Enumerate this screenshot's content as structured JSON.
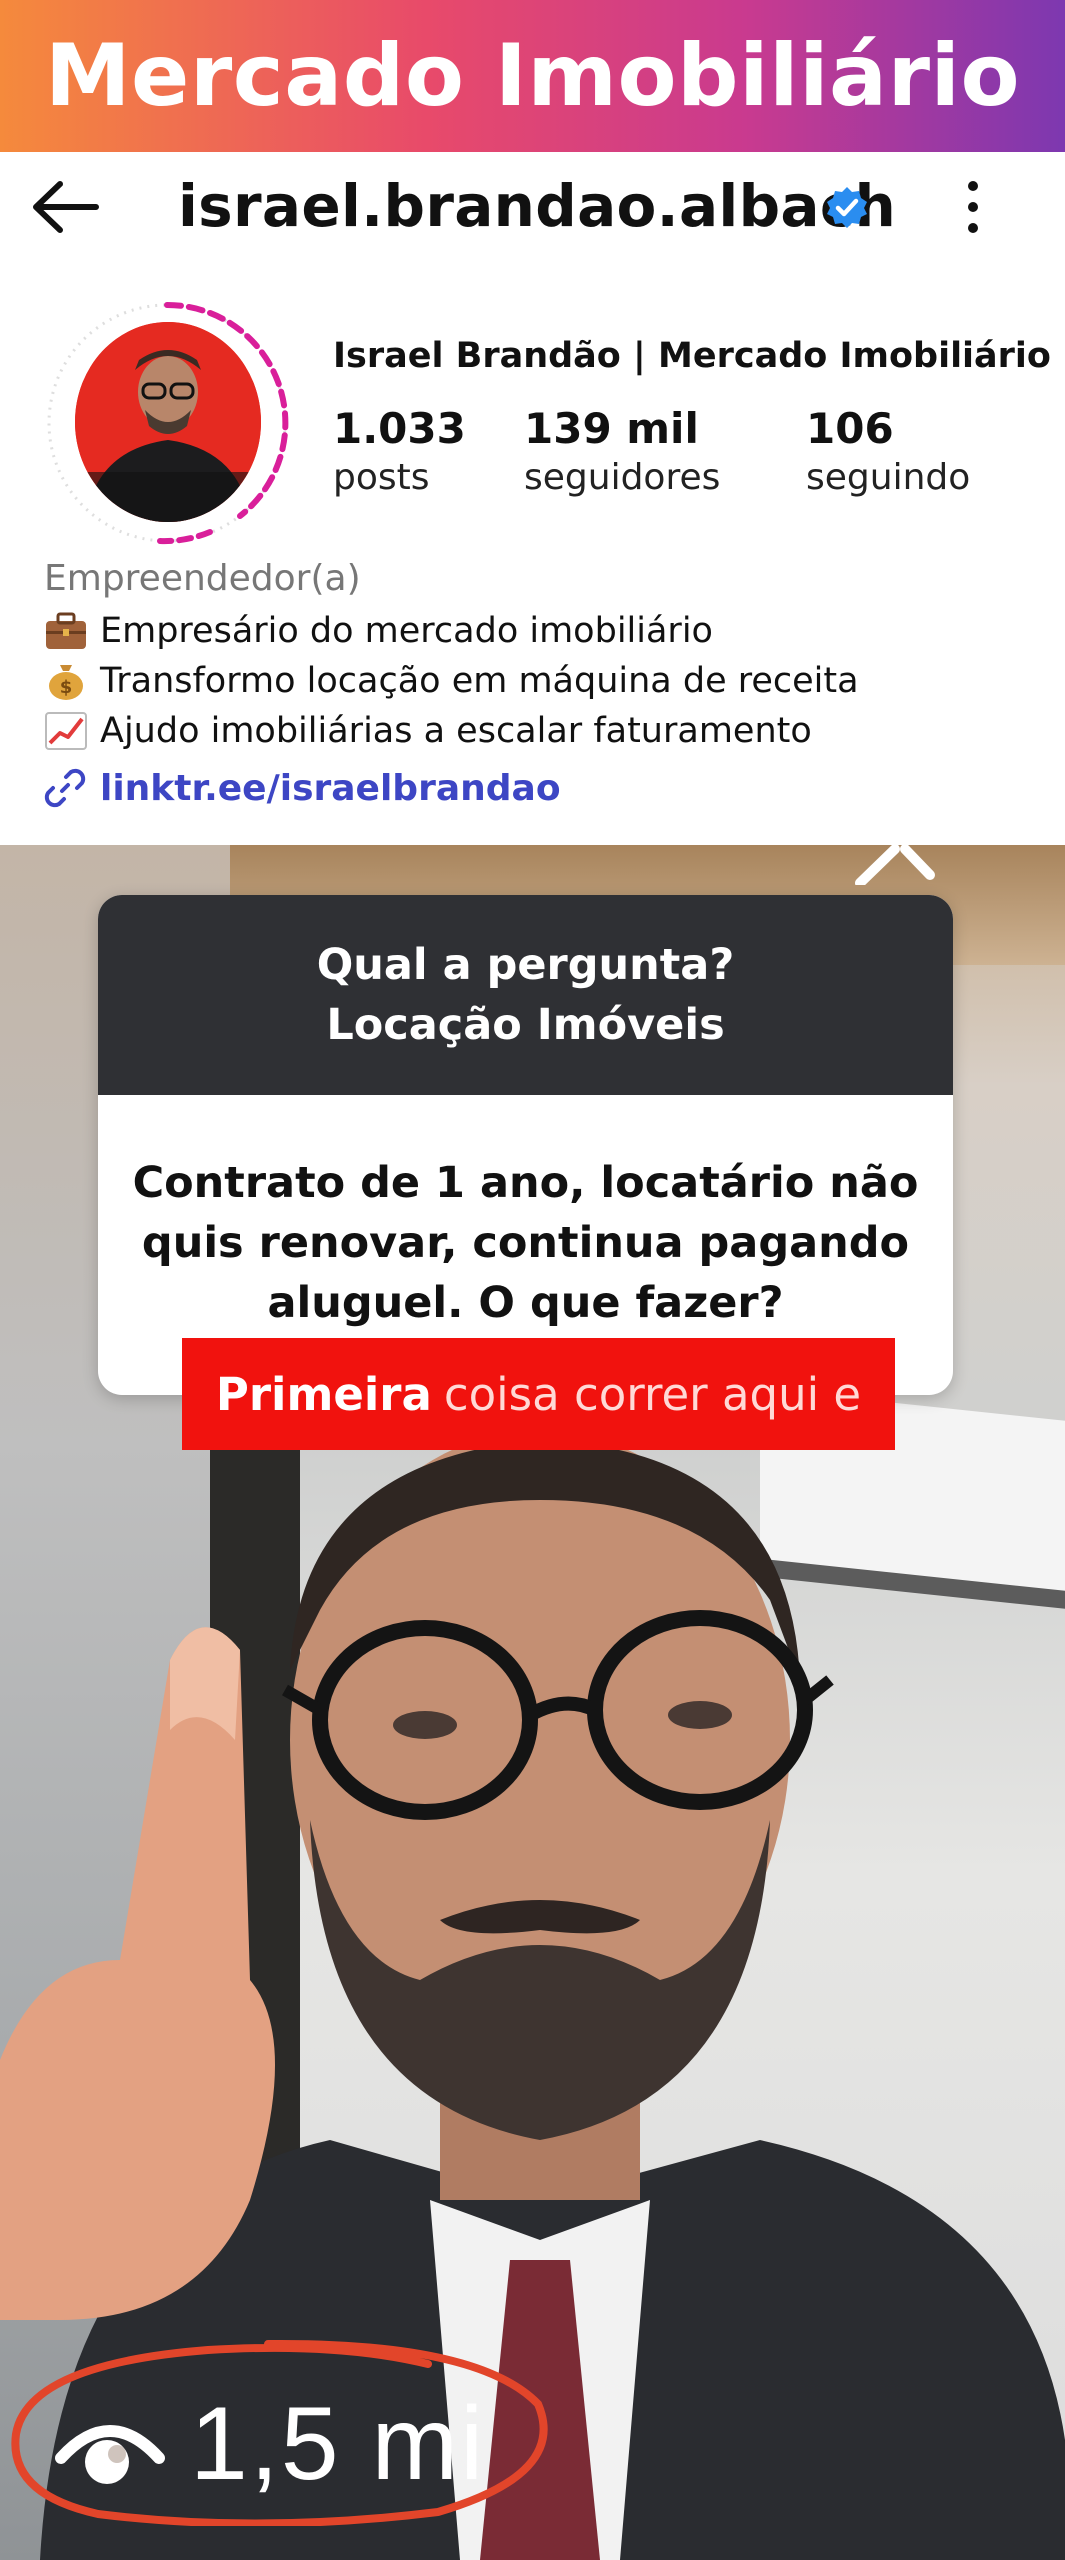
{
  "banner": {
    "title": "Mercado Imobiliário"
  },
  "profile": {
    "username": "israel.brandao.albach",
    "full_name": "Israel Brandão | Mercado Imobiliário",
    "stats": [
      {
        "value": "1.033",
        "label": "posts"
      },
      {
        "value": "139 mil",
        "label": "seguidores"
      },
      {
        "value": "106",
        "label": "seguindo"
      }
    ],
    "category": "Empreendedor(a)",
    "bio_lines": [
      {
        "icon": "briefcase-icon",
        "text": "Empresário do mercado imobiliário"
      },
      {
        "icon": "money-bag-icon",
        "text": "Transformo locação em máquina de receita"
      },
      {
        "icon": "chart-increasing-icon",
        "text": "Ajudo imobiliárias a escalar faturamento"
      }
    ],
    "link": "linktr.ee/israelbrandao"
  },
  "video": {
    "question_header": [
      "Qual a pergunta?",
      "Locação Imóveis"
    ],
    "question_body": [
      "Contrato de 1 ano, locatário não",
      "quis renovar, continua pagando",
      "aluguel. O que fazer?"
    ],
    "caption_highlight": "Primeira",
    "caption_rest": "coisa correr aqui e",
    "views": "1,5 mi"
  },
  "colors": {
    "accent_link": "#3d46c4",
    "verified": "#2a8df0",
    "caption_bg": "#f1120e",
    "views_circle": "#e2452a"
  }
}
